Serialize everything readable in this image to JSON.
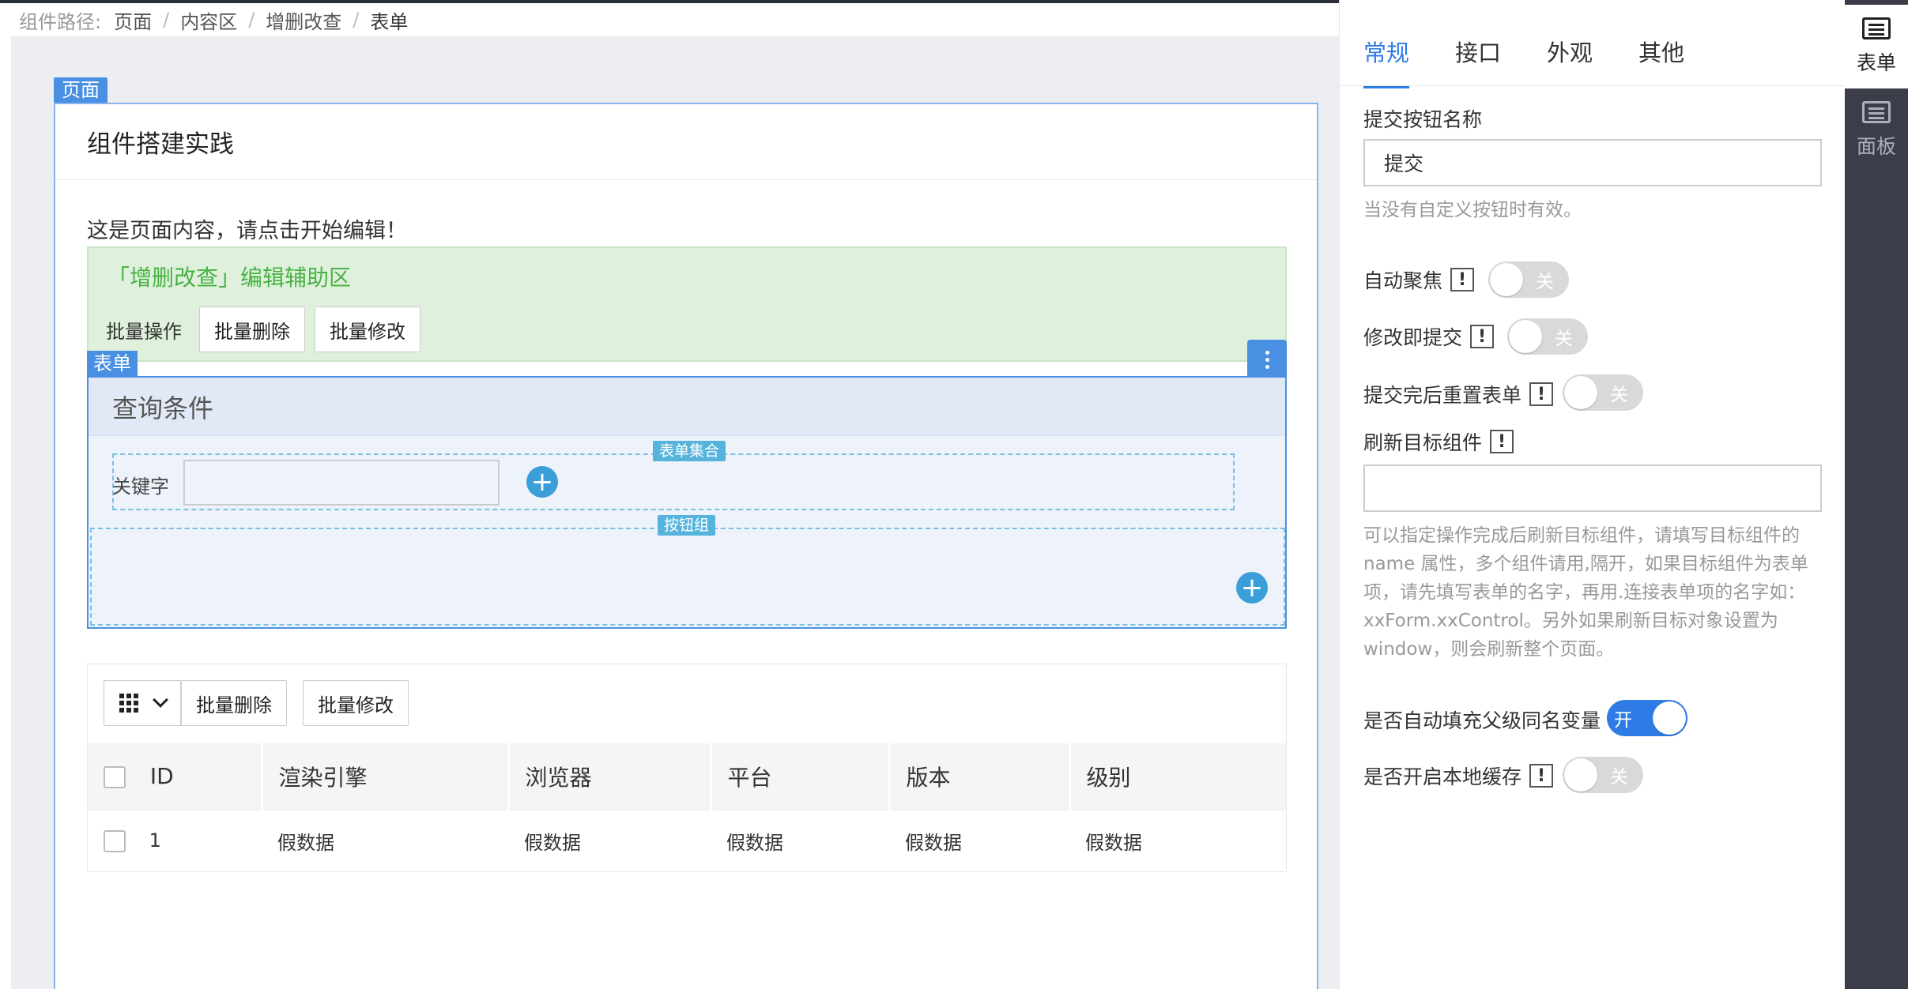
{
  "breadcrumb": {
    "label": "组件路径:",
    "items": [
      "页面",
      "内容区",
      "增删改查",
      "表单"
    ]
  },
  "canvas": {
    "page_tag": "页面",
    "page_title": "组件搭建实践",
    "intro": "这是页面内容，请点击开始编辑！",
    "crud_assist": {
      "title": "「增删改查」编辑辅助区",
      "batch_label": "批量操作",
      "batch_delete": "批量删除",
      "batch_edit": "批量修改"
    },
    "form": {
      "tag": "表单",
      "title": "查询条件",
      "collection_tag": "表单集合",
      "keyword_label": "关键字",
      "keyword_value": "",
      "button_group_tag": "按钮组"
    },
    "list": {
      "batch_delete": "批量删除",
      "batch_edit": "批量修改",
      "columns": [
        "ID",
        "渲染引擎",
        "浏览器",
        "平台",
        "版本",
        "级别"
      ],
      "rows": [
        [
          "1",
          "假数据",
          "假数据",
          "假数据",
          "假数据",
          "假数据"
        ]
      ]
    }
  },
  "panel": {
    "tabs": [
      "常规",
      "接口",
      "外观",
      "其他"
    ],
    "active_tab": "常规",
    "submit_name_label": "提交按钮名称",
    "submit_name_value": "提交",
    "submit_name_help": "当没有自定义按钮时有效。",
    "autofocus_label": "自动聚焦",
    "autofocus_state": "关",
    "submit_on_change_label": "修改即提交",
    "submit_on_change_state": "关",
    "reset_after_submit_label": "提交完后重置表单",
    "reset_after_submit_state": "关",
    "reload_target_label": "刷新目标组件",
    "reload_target_value": "",
    "reload_target_help": "可以指定操作完成后刷新目标组件，请填写目标组件的 name 属性，多个组件请用,隔开，如果目标组件为表单项，请先填写表单的名字，再用.连接表单项的名字如：xxForm.xxControl。另外如果刷新目标对象设置为 window，则会刷新整个页面。",
    "auto_fill_label": "是否自动填充父级同名变量",
    "auto_fill_state": "开",
    "local_cache_label": "是否开启本地缓存",
    "local_cache_state": "关"
  },
  "sidebar": {
    "items": [
      {
        "label": "表单",
        "icon": "form-icon",
        "active": true
      },
      {
        "label": "面板",
        "icon": "panel-icon",
        "active": false
      }
    ]
  },
  "colors": {
    "accent": "#2f7be5",
    "editor_blue": "#4a90e2",
    "assist_green": "#48b244",
    "sidebar_dark": "#3b3d48"
  }
}
